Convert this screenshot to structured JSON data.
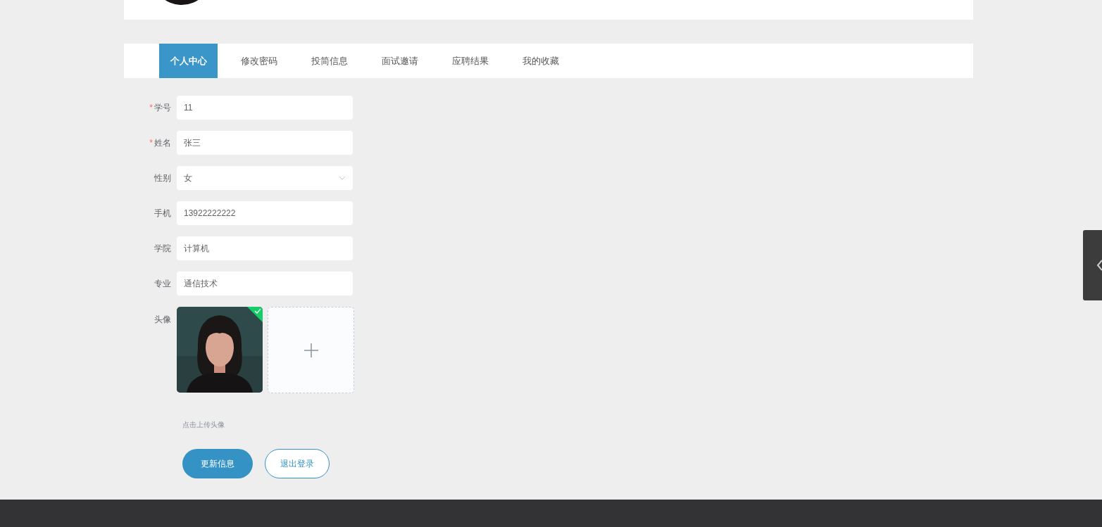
{
  "tabs": [
    {
      "label": "个人中心",
      "selected": true
    },
    {
      "label": "修改密码",
      "selected": false
    },
    {
      "label": "投简信息",
      "selected": false
    },
    {
      "label": "面试邀请",
      "selected": false
    },
    {
      "label": "应聘结果",
      "selected": false
    },
    {
      "label": "我的收藏",
      "selected": false
    }
  ],
  "form": {
    "fields": [
      {
        "kind": "text",
        "label": "学号",
        "required_mark": "*",
        "value": "11"
      },
      {
        "kind": "text",
        "label": "姓名",
        "required_mark": "*",
        "value": "张三"
      },
      {
        "kind": "select",
        "label": "性别",
        "value": "女"
      },
      {
        "kind": "text",
        "label": "手机",
        "value": "13922222222"
      },
      {
        "kind": "text",
        "label": "学院",
        "value": "计算机"
      },
      {
        "kind": "text",
        "label": "专业",
        "value": "通信技术"
      },
      {
        "kind": "upload",
        "label": "头像",
        "uploaded": true
      }
    ],
    "hint": "点击上传头像",
    "buttons": [
      {
        "kind": "primary",
        "label": "更新信息"
      },
      {
        "kind": "outline",
        "label": "退出登录"
      }
    ]
  }
}
